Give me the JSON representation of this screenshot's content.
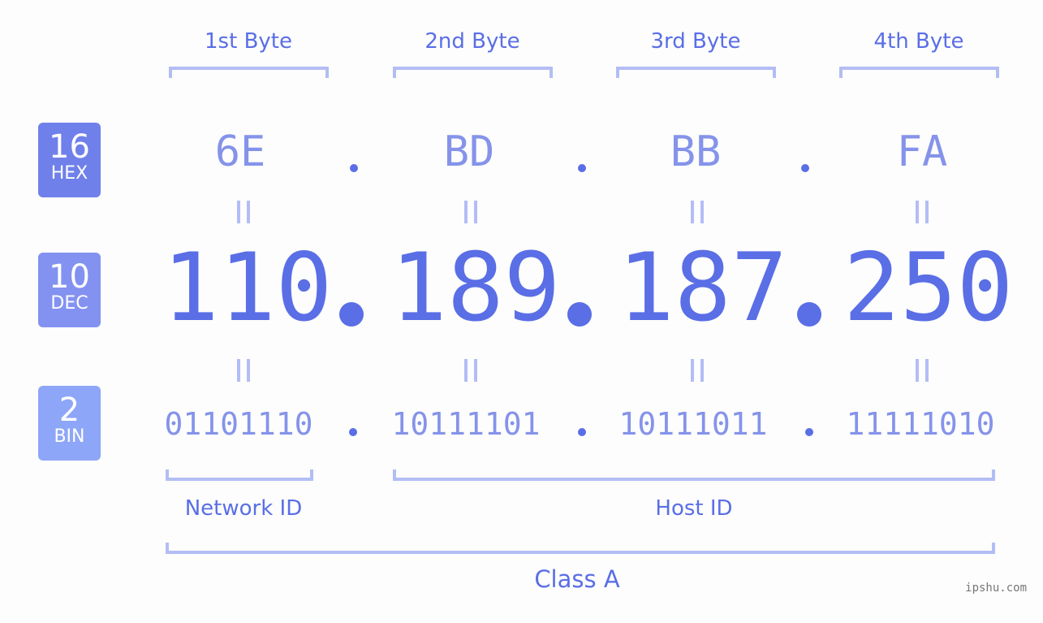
{
  "byte_headers": [
    "1st Byte",
    "2nd Byte",
    "3rd Byte",
    "4th Byte"
  ],
  "badges": {
    "hex": {
      "num": "16",
      "unit": "HEX",
      "color": "#7080ea"
    },
    "dec": {
      "num": "10",
      "unit": "DEC",
      "color": "#8392f0"
    },
    "bin": {
      "num": "2",
      "unit": "BIN",
      "color": "#8ea6f7"
    }
  },
  "hex": [
    "6E",
    "BD",
    "BB",
    "FA"
  ],
  "dec": [
    "110",
    "189",
    "187",
    "250"
  ],
  "bin": [
    "01101110",
    "10111101",
    "10111011",
    "11111010"
  ],
  "labels": {
    "network_id": "Network ID",
    "host_id": "Host ID",
    "class": "Class A"
  },
  "watermark": "ipshu.com",
  "colors": {
    "accent": "#5a6ee6",
    "light": "#8593ea",
    "bracket": "#b3bdf5"
  }
}
